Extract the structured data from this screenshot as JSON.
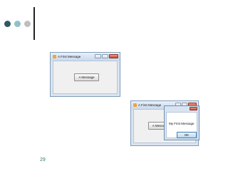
{
  "slide": {
    "page_number": "29"
  },
  "window1": {
    "title": "A First Message",
    "button_label": "A Message"
  },
  "window2": {
    "title": "A First Message",
    "button_label": "A Message"
  },
  "message_box": {
    "text": "My First Message",
    "ok_label": "OK"
  },
  "colors": {
    "dot1": "#2f5960",
    "dot2": "#8fc1c9",
    "dot3": "#bfbfbf",
    "accent": "#2e7d6f"
  }
}
